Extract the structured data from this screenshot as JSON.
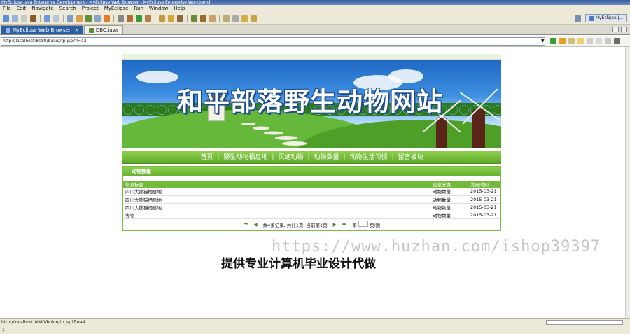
{
  "window": {
    "title": "MyEclipse Java Enterprise Development - MyEclipse Web Browser - MyEclipse Enterprise Workbench"
  },
  "menubar": [
    "File",
    "Edit",
    "Navigate",
    "Search",
    "Project",
    "MyEclipse",
    "Run",
    "Window",
    "Help"
  ],
  "perspective": {
    "label": "MyEclipse J..."
  },
  "tabs": [
    {
      "label": "MyEclipse Web Browser",
      "active": true
    },
    {
      "label": "DBO.java",
      "active": false
    }
  ],
  "address": {
    "value": "http://localhost:8080/buluo/tp.jsp?fl=a3"
  },
  "site": {
    "title": "和平部落野生动物网站",
    "nav": [
      "首页",
      "野生动物栖息地",
      "灭绝动物",
      "动物数量",
      "动物生活习惯",
      "留言板块"
    ],
    "panel_title": "动物数量",
    "table": {
      "headers": [
        "信息标题",
        "信息分类",
        "发布时间"
      ],
      "rows": [
        [
          "四川大熊猫栖息地",
          "动物数量",
          "2015-03-21"
        ],
        [
          "四川大熊猫栖息地",
          "动物数量",
          "2015-03-21"
        ],
        [
          "四川大熊猫栖息地",
          "动物数量",
          "2015-03-21"
        ],
        [
          "等等",
          "动物数量",
          "2015-03-21"
        ]
      ]
    },
    "pager": {
      "first": "⏮",
      "prev": "◀",
      "summary": "共4条记录, 共计1页, 当前第1页",
      "next": "▶",
      "last": "⏭",
      "goto_prefix": "第",
      "goto_suffix": "页/跳"
    }
  },
  "overlay": {
    "watermark": "https://www.huzhan.com/ishop39397",
    "caption": "提供专业计算机毕业设计代做"
  },
  "status": {
    "url": "http://localhost:8080/buluo/tp.jsp?fl=a4"
  },
  "colors": {
    "nav_green": "#6fb634",
    "ide_bg": "#ece9d8",
    "tab_active": "#2d5fa3"
  }
}
